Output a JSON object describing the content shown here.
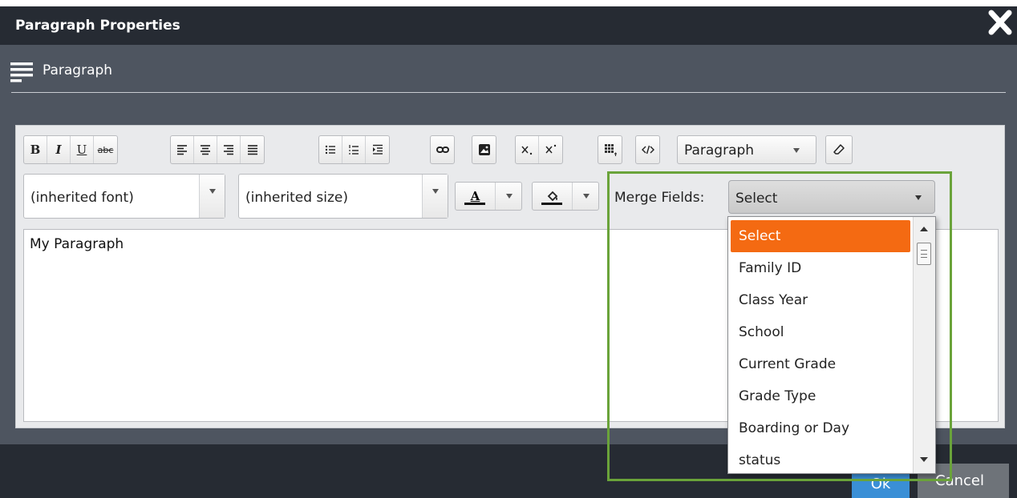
{
  "dialog": {
    "title": "Paragraph Properties",
    "section_label": "Paragraph"
  },
  "toolbar": {
    "bold_label": "B",
    "italic_label": "I",
    "underline_label": "U",
    "strike_label": "abc",
    "format_value": "Paragraph",
    "font_value": "(inherited font)",
    "size_value": "(inherited size)",
    "text_color_label": "A",
    "merge_label": "Merge Fields:",
    "merge_value": "Select"
  },
  "editor": {
    "content": "My Paragraph"
  },
  "merge_dropdown": {
    "items": [
      "Select",
      "Family ID",
      "Class Year",
      "School",
      "Current Grade",
      "Grade Type",
      "Boarding or Day",
      "status"
    ]
  },
  "footer": {
    "ok_label": "Ok",
    "cancel_label": "Cancel"
  },
  "colors": {
    "title_bar": "#262b33",
    "dialog_body": "#4e5560",
    "selected_item": "#f46a12",
    "highlight_border": "#6aa33a",
    "ok_button": "#3a8fd6"
  }
}
